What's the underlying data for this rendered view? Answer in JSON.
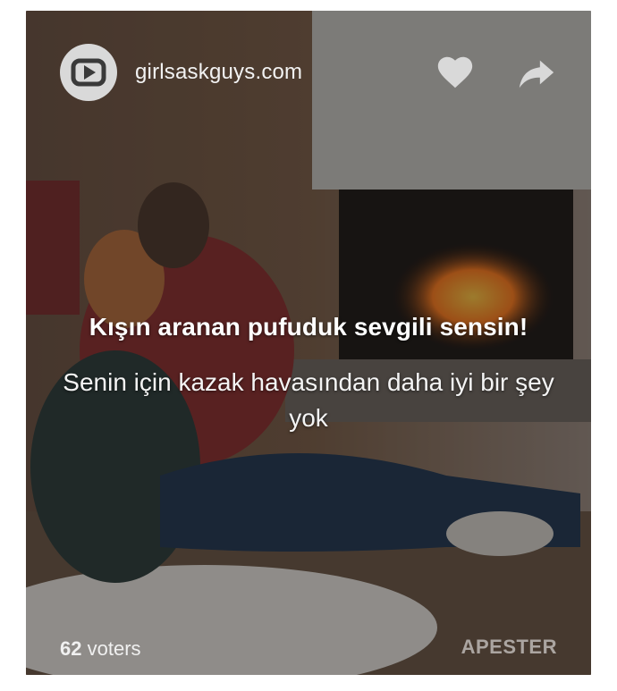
{
  "header": {
    "site_name": "girlsaskguys.com",
    "logo_icon": "play-logo-icon",
    "like_icon": "heart-icon",
    "share_icon": "share-arrow-icon"
  },
  "content": {
    "title": "Kışın aranan pufuduk sevgili sensin!",
    "subtitle": "Senin için kazak havasından daha iyi bir şey yok"
  },
  "footer": {
    "voters_count": "62",
    "voters_label": "voters",
    "brand": "APESTER"
  },
  "colors": {
    "overlay": "#1a1a1a",
    "text": "#ffffff",
    "logo_bg": "#d9d9d9"
  }
}
